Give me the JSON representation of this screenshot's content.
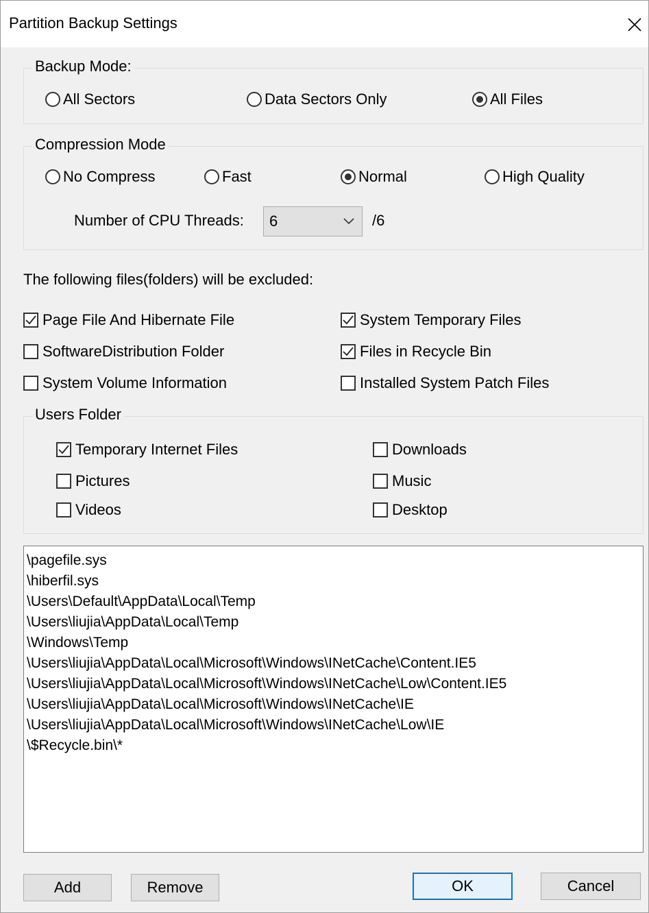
{
  "window": {
    "title": "Partition Backup Settings"
  },
  "backup_mode": {
    "label": "Backup Mode:",
    "options": [
      "All Sectors",
      "Data Sectors Only",
      "All Files"
    ],
    "selected": "All Files"
  },
  "compression_mode": {
    "label": "Compression Mode",
    "options": [
      "No Compress",
      "Fast",
      "Normal",
      "High Quality"
    ],
    "selected": "Normal",
    "threads_label": "Number of CPU Threads:",
    "threads_value": "6",
    "threads_max": "/6"
  },
  "exclude": {
    "label": "The following files(folders) will be excluded:",
    "items": [
      {
        "label": "Page File And Hibernate File",
        "checked": true
      },
      {
        "label": "System Temporary Files",
        "checked": true
      },
      {
        "label": "SoftwareDistribution Folder",
        "checked": false
      },
      {
        "label": "Files in Recycle Bin",
        "checked": true
      },
      {
        "label": "System Volume Information",
        "checked": false
      },
      {
        "label": "Installed System Patch Files",
        "checked": false
      }
    ]
  },
  "users_folder": {
    "label": "Users Folder",
    "items": [
      {
        "label": "Temporary Internet Files",
        "checked": true
      },
      {
        "label": "Downloads",
        "checked": false
      },
      {
        "label": "Pictures",
        "checked": false
      },
      {
        "label": "Music",
        "checked": false
      },
      {
        "label": "Videos",
        "checked": false
      },
      {
        "label": "Desktop",
        "checked": false
      }
    ]
  },
  "paths": [
    "\\pagefile.sys",
    "\\hiberfil.sys",
    "\\Users\\Default\\AppData\\Local\\Temp",
    "\\Users\\liujia\\AppData\\Local\\Temp",
    "\\Windows\\Temp",
    "\\Users\\liujia\\AppData\\Local\\Microsoft\\Windows\\INetCache\\Content.IE5",
    "\\Users\\liujia\\AppData\\Local\\Microsoft\\Windows\\INetCache\\Low\\Content.IE5",
    "\\Users\\liujia\\AppData\\Local\\Microsoft\\Windows\\INetCache\\IE",
    "\\Users\\liujia\\AppData\\Local\\Microsoft\\Windows\\INetCache\\Low\\IE",
    "\\$Recycle.bin\\*"
  ],
  "buttons": {
    "add": "Add",
    "remove": "Remove",
    "ok": "OK",
    "cancel": "Cancel"
  },
  "colors": {
    "accent": "#0078d7",
    "dialog_bg": "#f0f0f0"
  }
}
